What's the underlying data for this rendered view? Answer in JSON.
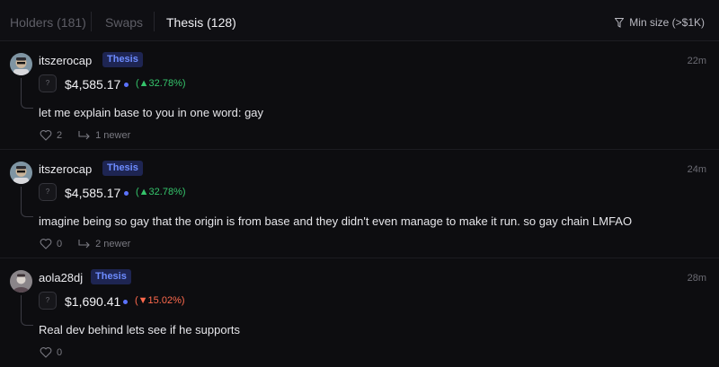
{
  "tabs": [
    {
      "label": "Holders (181)"
    },
    {
      "label": "Swaps"
    },
    {
      "label": "Thesis (128)"
    }
  ],
  "filter": {
    "label": "Min size (>$1K)",
    "icon": "filter-icon"
  },
  "posts": [
    {
      "username": "itszerocap",
      "badge": "Thesis",
      "time": "22m",
      "token_icon": "?",
      "amount": "$4,585.17",
      "change": "(▲32.78%)",
      "direction": "up",
      "message": "let me explain base to you in one word: gay",
      "likes": "2",
      "replies": "1 newer"
    },
    {
      "username": "itszerocap",
      "badge": "Thesis",
      "time": "24m",
      "token_icon": "?",
      "amount": "$4,585.17",
      "change": "(▲32.78%)",
      "direction": "up",
      "message": "imagine being so gay that the origin is from base and they didn't even manage to make it run. so gay chain LMFAO",
      "likes": "0",
      "replies": "2 newer"
    },
    {
      "username": "aola28dj",
      "badge": "Thesis",
      "time": "28m",
      "token_icon": "?",
      "amount": "$1,690.41",
      "change": "(▼15.02%)",
      "direction": "down",
      "message": "Real dev behind lets see if he supports",
      "likes": "0"
    }
  ],
  "colors": {
    "background": "#0d0d10",
    "badge_text": "#6d8cff",
    "badge_bg": "#1e2552",
    "positive": "#35c46b",
    "negative": "#ff6a4d",
    "dot": "#5b73ff"
  }
}
